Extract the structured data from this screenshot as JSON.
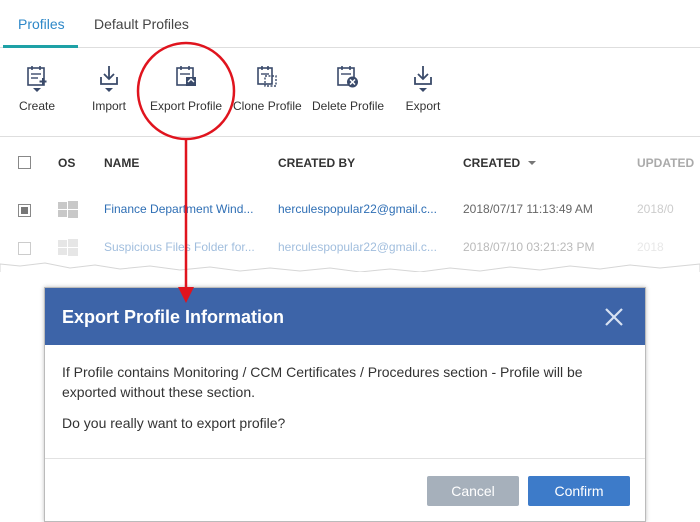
{
  "tabs": [
    {
      "label": "Profiles",
      "active": true
    },
    {
      "label": "Default Profiles",
      "active": false
    }
  ],
  "toolbar": {
    "create": "Create",
    "import": "Import",
    "export_profile": "Export Profile",
    "clone_profile": "Clone Profile",
    "delete_profile": "Delete Profile",
    "export": "Export"
  },
  "table": {
    "headers": {
      "os": "OS",
      "name": "NAME",
      "created_by": "CREATED BY",
      "created": "CREATED",
      "updated": "UPDATED"
    },
    "rows": [
      {
        "name": "Finance Department Wind...",
        "created_by": "herculespopular22@gmail.c...",
        "created": "2018/07/17 11:13:49 AM",
        "updated": "2018/0",
        "checked": true
      },
      {
        "name": "Suspicious Files Folder for...",
        "created_by": "herculespopular22@gmail.c...",
        "created": "2018/07/10 03:21:23 PM",
        "updated": "2018",
        "checked": false
      }
    ]
  },
  "dialog": {
    "title": "Export Profile Information",
    "message1": "If Profile contains Monitoring / CCM Certificates / Procedures section - Profile will be exported without these section.",
    "message2": "Do you really want to export profile?",
    "cancel": "Cancel",
    "confirm": "Confirm"
  },
  "colors": {
    "dialog_header": "#3d64a8",
    "confirm_button": "#3d7bc9",
    "cancel_button": "#a6b0bb",
    "annotation": "#e0141e",
    "tab_accent": "#1ea1a6"
  }
}
